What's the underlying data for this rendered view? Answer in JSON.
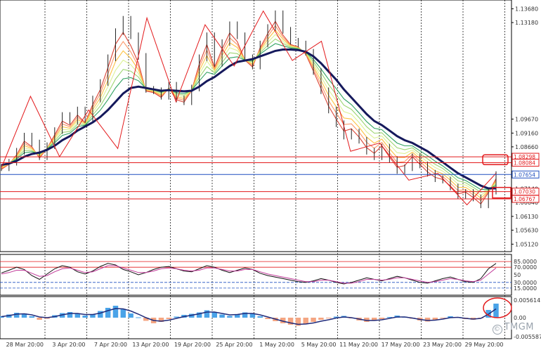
{
  "chart_data": {
    "type": "line",
    "symbol_hint": "EURUSD daily-style H4 chart",
    "price_axis": {
      "ticks": [
        "1.13680",
        "1.13180",
        "1.09670",
        "1.09160",
        "1.08660",
        "1.08160",
        "1.07140",
        "1.06640",
        "1.06130",
        "1.05630",
        "1.05120"
      ],
      "range": [
        1.049,
        1.1395
      ]
    },
    "x_labels": [
      "28 Mar 20:00",
      "3 Apr 20:00",
      "7 Apr 20:00",
      "13 Apr 20:00",
      "19 Apr 20:00",
      "25 Apr 20:00",
      "1 May 20:00",
      "5 May 20:00",
      "11 May 20:00",
      "17 May 20:00",
      "23 May 20:00",
      "29 May 20:00"
    ],
    "price_tags": [
      {
        "text": "1.08298",
        "price": 1.08298,
        "color": "#e31a1c",
        "style": "solid"
      },
      {
        "text": "1.08084",
        "price": 1.08084,
        "color": "#e31a1c",
        "style": "solid"
      },
      {
        "text": "1.07654",
        "price": 1.07654,
        "color": "#1f4fbf",
        "style": "solid"
      },
      {
        "text": "1.07030",
        "price": 1.0703,
        "color": "#e31a1c",
        "style": "solid"
      },
      {
        "text": "1.06767",
        "price": 1.06767,
        "color": "#e31a1c",
        "style": "solid"
      }
    ],
    "price_series": [
      {
        "name": "close",
        "values": [
          1.079,
          1.081,
          1.085,
          1.0905,
          1.088,
          1.083,
          1.087,
          1.0925,
          1.098,
          1.096,
          1.1,
          1.0965,
          1.104,
          1.11,
          1.119,
          1.1285,
          1.133,
          1.127,
          1.1195,
          1.1075,
          1.107,
          1.105,
          1.109,
          1.104,
          1.103,
          1.108,
          1.119,
          1.127,
          1.117,
          1.1245,
          1.131,
          1.127,
          1.119,
          1.116,
          1.124,
          1.13,
          1.135,
          1.129,
          1.125,
          1.124,
          1.121,
          1.114,
          1.107,
          1.1,
          1.095,
          1.0905,
          1.092,
          1.089,
          1.085,
          1.083,
          1.0865,
          1.082,
          1.078,
          1.079,
          1.083,
          1.08,
          1.077,
          1.075,
          1.0745,
          1.072,
          1.069,
          1.07,
          1.068,
          1.0655,
          1.0705,
          1.0765
        ],
        "ma": [
          1.08,
          1.0805,
          1.0815,
          1.083,
          1.084,
          1.0845,
          1.0855,
          1.087,
          1.089,
          1.0905,
          1.0925,
          1.094,
          1.0955,
          1.0975,
          1.1,
          1.103,
          1.106,
          1.108,
          1.1085,
          1.108,
          1.1075,
          1.107,
          1.1072,
          1.107,
          1.1068,
          1.107,
          1.1085,
          1.1105,
          1.112,
          1.114,
          1.116,
          1.1175,
          1.118,
          1.1185,
          1.1195,
          1.1205,
          1.1215,
          1.122,
          1.122,
          1.1218,
          1.1212,
          1.1195,
          1.117,
          1.114,
          1.111,
          1.1075,
          1.1045,
          1.1015,
          1.0985,
          1.096,
          1.0945,
          1.0925,
          1.0905,
          1.089,
          1.088,
          1.0865,
          1.085,
          1.083,
          1.081,
          1.079,
          1.077,
          1.0755,
          1.074,
          1.0725,
          1.0715,
          1.0715
        ]
      }
    ],
    "zigzag": [
      1.079,
      1.105,
      1.083,
      1.1,
      1.086,
      1.1335,
      1.103,
      1.131,
      1.116,
      1.136,
      1.118,
      1.125,
      1.085,
      1.088,
      1.0745,
      1.077,
      1.0655,
      1.077
    ],
    "oscillator": {
      "levels": [
        {
          "text": "85.0000",
          "value": 85
        },
        {
          "text": "70.0000",
          "value": 70
        },
        {
          "text": "30.0000",
          "value": 30
        },
        {
          "text": "15.0000",
          "value": 15
        }
      ],
      "mid_label": "50",
      "range": [
        0,
        100
      ],
      "series": [
        {
          "name": "fast",
          "values": [
            55,
            62,
            70,
            64,
            48,
            38,
            52,
            66,
            74,
            70,
            58,
            52,
            60,
            72,
            80,
            76,
            64,
            58,
            50,
            56,
            64,
            70,
            72,
            66,
            60,
            58,
            66,
            74,
            70,
            62,
            56,
            62,
            68,
            64,
            54,
            48,
            44,
            40,
            36,
            32,
            30,
            34,
            40,
            36,
            30,
            26,
            30,
            36,
            42,
            38,
            34,
            40,
            46,
            42,
            36,
            30,
            28,
            34,
            40,
            44,
            38,
            32,
            30,
            40,
            66,
            80
          ]
        },
        {
          "name": "slow",
          "values": [
            52,
            56,
            62,
            62,
            54,
            46,
            48,
            58,
            66,
            68,
            62,
            56,
            58,
            66,
            74,
            74,
            68,
            62,
            56,
            56,
            60,
            66,
            68,
            66,
            62,
            60,
            62,
            68,
            68,
            64,
            60,
            60,
            64,
            64,
            58,
            52,
            48,
            44,
            40,
            36,
            32,
            32,
            36,
            36,
            32,
            28,
            28,
            32,
            38,
            38,
            36,
            38,
            42,
            42,
            38,
            34,
            30,
            32,
            36,
            40,
            38,
            34,
            32,
            36,
            52,
            68
          ]
        }
      ]
    },
    "histogram": {
      "label_top": "0.005614",
      "label_mid": "0.00",
      "label_bottom": "-0.005587",
      "range": [
        -0.0056,
        0.0056
      ],
      "bars": [
        0.0004,
        0.0009,
        0.0014,
        0.0012,
        0.0004,
        -0.0006,
        -0.0003,
        0.0007,
        0.0013,
        0.0016,
        0.0011,
        0.0006,
        0.001,
        0.0019,
        0.0028,
        0.0034,
        0.0025,
        0.0012,
        0.0001,
        -0.0009,
        -0.0016,
        -0.0012,
        -0.0004,
        0.0003,
        0.0008,
        0.0011,
        0.0015,
        0.0021,
        0.0016,
        0.0009,
        0.0005,
        0.001,
        0.0015,
        0.0012,
        0.0004,
        -0.0004,
        -0.001,
        -0.0016,
        -0.002,
        -0.0023,
        -0.0018,
        -0.0012,
        -0.0006,
        -0.0002,
        0.0003,
        0.0005,
        -0.0002,
        -0.0008,
        -0.0012,
        -0.0009,
        -0.0004,
        0.0002,
        0.0006,
        0.0003,
        -0.0003,
        -0.0008,
        -0.0011,
        -0.0007,
        -0.0002,
        0.0004,
        0.0002,
        -0.0004,
        -0.0006,
        -0.0001,
        0.0022,
        0.004
      ],
      "signal": [
        0.0003,
        0.0006,
        0.001,
        0.0011,
        0.0008,
        0.0002,
        0.0,
        0.0003,
        0.0008,
        0.0012,
        0.0012,
        0.0009,
        0.0009,
        0.0013,
        0.002,
        0.0026,
        0.0025,
        0.0019,
        0.001,
        0.0,
        -0.0008,
        -0.001,
        -0.0007,
        -0.0002,
        0.0003,
        0.0007,
        0.0011,
        0.0016,
        0.0016,
        0.0012,
        0.0008,
        0.0009,
        0.0012,
        0.0012,
        0.0008,
        0.0002,
        -0.0004,
        -0.001,
        -0.0015,
        -0.0019,
        -0.0018,
        -0.0015,
        -0.001,
        -0.0006,
        -0.0001,
        0.0002,
        0.0,
        -0.0004,
        -0.0008,
        -0.0008,
        -0.0006,
        -0.0002,
        0.0002,
        0.0002,
        -0.0001,
        -0.0005,
        -0.0008,
        -0.0007,
        -0.0004,
        0.0,
        0.0001,
        -0.0002,
        -0.0004,
        -0.0002,
        0.001,
        0.0025
      ]
    },
    "watermark": "TMGM",
    "colors": {
      "ribbon": [
        "#d7301f",
        "#fc8d59",
        "#fdbb2d",
        "#d9ef8b",
        "#91cf60",
        "#1a9850"
      ],
      "ma_line": "#15195c",
      "zigzag": "#e31a1c",
      "hist_pos": "#4aa3e8",
      "hist_neg": "#f4a582",
      "signal": "#1f2a7a",
      "highlight": "#e31a1c"
    }
  }
}
